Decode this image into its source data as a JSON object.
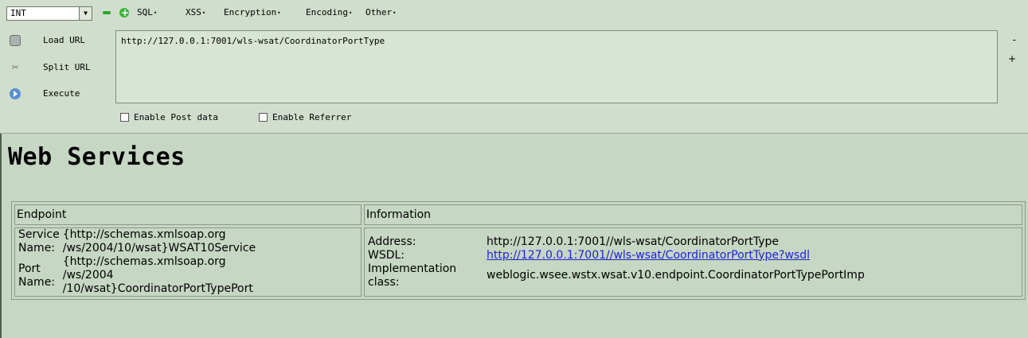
{
  "toolbar": {
    "select_value": "INT",
    "menus": [
      "SQL",
      "XSS",
      "Encryption",
      "Encoding",
      "Other"
    ],
    "load_url": "Load URL",
    "split_url": "Split URL",
    "execute": "Execute",
    "url": "http://127.0.0.1:7001/wls-wsat/CoordinatorPortType",
    "minus": "-",
    "plus": "+",
    "enable_post": "Enable Post data",
    "enable_referrer": "Enable Referrer"
  },
  "page": {
    "title": "Web Services",
    "headers": {
      "endpoint": "Endpoint",
      "information": "Information"
    },
    "endpoint": {
      "service_label": "Service Name:",
      "service_value_1": "{http://schemas.xmlsoap.org",
      "service_value_2": "/ws/2004/10/wsat}WSAT10Service",
      "port_label": "Port Name:",
      "port_value_1": "{http://schemas.xmlsoap.org",
      "port_value_2": "/ws/2004",
      "port_value_3": "/10/wsat}CoordinatorPortTypePort"
    },
    "info": {
      "address_label": "Address:",
      "address_value": "http://127.0.0.1:7001//wls-wsat/CoordinatorPortType",
      "wsdl_label": "WSDL:",
      "wsdl_value": "http://127.0.0.1:7001//wls-wsat/CoordinatorPortType?wsdl",
      "impl_label": "Implementation class:",
      "impl_value": "weblogic.wsee.wstx.wsat.v10.endpoint.CoordinatorPortTypePortImp"
    }
  }
}
